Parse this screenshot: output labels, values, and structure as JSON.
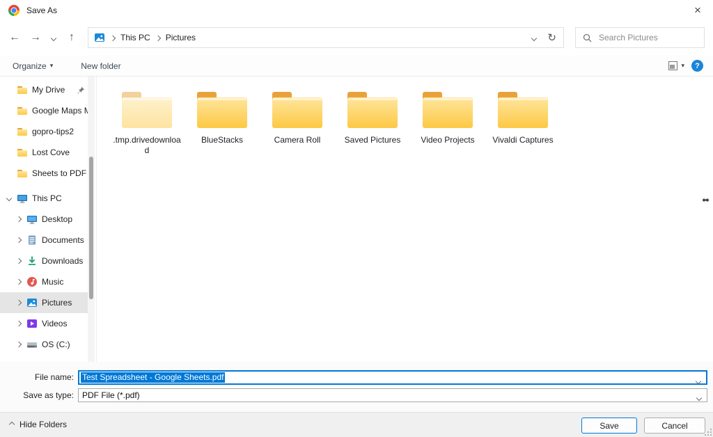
{
  "window": {
    "title": "Save As"
  },
  "icons": {
    "back": "←",
    "forward": "→",
    "up": "↑",
    "close": "×",
    "refresh": "↻",
    "organize_caret": "▾",
    "view_caret": "▾",
    "help": "?"
  },
  "navbar": {
    "crumb_root": "This PC",
    "crumb_current": "Pictures",
    "search_placeholder": "Search Pictures"
  },
  "toolbar": {
    "organize": "Organize",
    "new_folder": "New folder"
  },
  "sidebar": {
    "quick": [
      {
        "label": "My Drive"
      },
      {
        "label": "Google Maps M"
      },
      {
        "label": "gopro-tips2"
      },
      {
        "label": "Lost Cove"
      },
      {
        "label": "Sheets to PDF"
      }
    ],
    "this_pc": "This PC",
    "children": [
      {
        "label": "Desktop"
      },
      {
        "label": "Documents"
      },
      {
        "label": "Downloads"
      },
      {
        "label": "Music"
      },
      {
        "label": "Pictures"
      },
      {
        "label": "Videos"
      },
      {
        "label": "OS (C:)"
      }
    ]
  },
  "files": {
    "folders": [
      ".tmp.drivedownload",
      "BlueStacks",
      "Camera Roll",
      "Saved Pictures",
      "Video Projects",
      "Vivaldi Captures"
    ]
  },
  "fields": {
    "file_name_label": "File name:",
    "file_name_value": "Test Spreadsheet - Google Sheets.pdf",
    "save_type_label": "Save as type:",
    "save_type_value": "PDF File (*.pdf)"
  },
  "footer": {
    "hide_folders": "Hide Folders",
    "save": "Save",
    "cancel": "Cancel"
  },
  "colors": {
    "accent": "#0078d7",
    "help_blue": "#1c84d8",
    "folder_tab": "#e9a23b",
    "folder_light": "#ffe59e",
    "folder_deep": "#fdc944",
    "selected_row": "#e5e5e5"
  }
}
